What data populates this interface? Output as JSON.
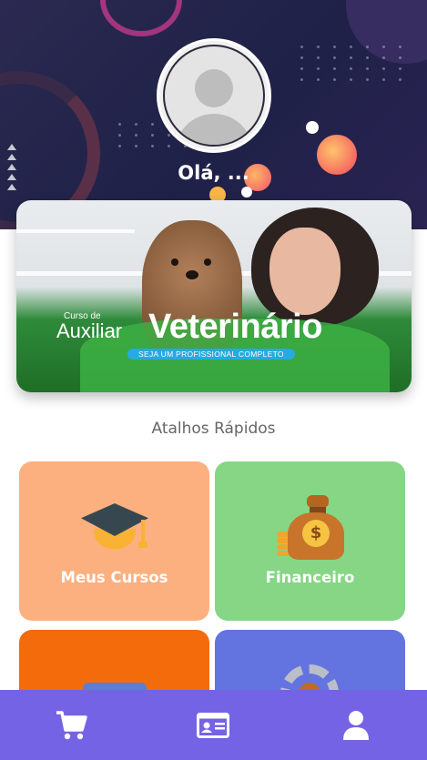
{
  "header": {
    "greeting": "Olá, ...",
    "avatar_icon": "user-avatar-placeholder"
  },
  "banner": {
    "small_text": "Curso de",
    "line1": "Auxiliar",
    "line2": "Veterinário",
    "tagline": "SEJA UM PROFISSIONAL COMPLETO"
  },
  "shortcuts": {
    "title": "Atalhos Rápidos",
    "tiles": [
      {
        "label": "Meus Cursos",
        "icon": "graduation-cap-icon",
        "color": "#fcb07f"
      },
      {
        "label": "Financeiro",
        "icon": "money-bag-icon",
        "color": "#86d685"
      },
      {
        "label": "",
        "icon": "folder-icon",
        "color": "#f46b0b"
      },
      {
        "label": "",
        "icon": "gear-icon",
        "color": "#6373e0"
      }
    ]
  },
  "bottom_nav": {
    "color": "#7563e6",
    "items": [
      {
        "icon": "cart-icon"
      },
      {
        "icon": "id-card-icon"
      },
      {
        "icon": "user-icon"
      }
    ]
  }
}
